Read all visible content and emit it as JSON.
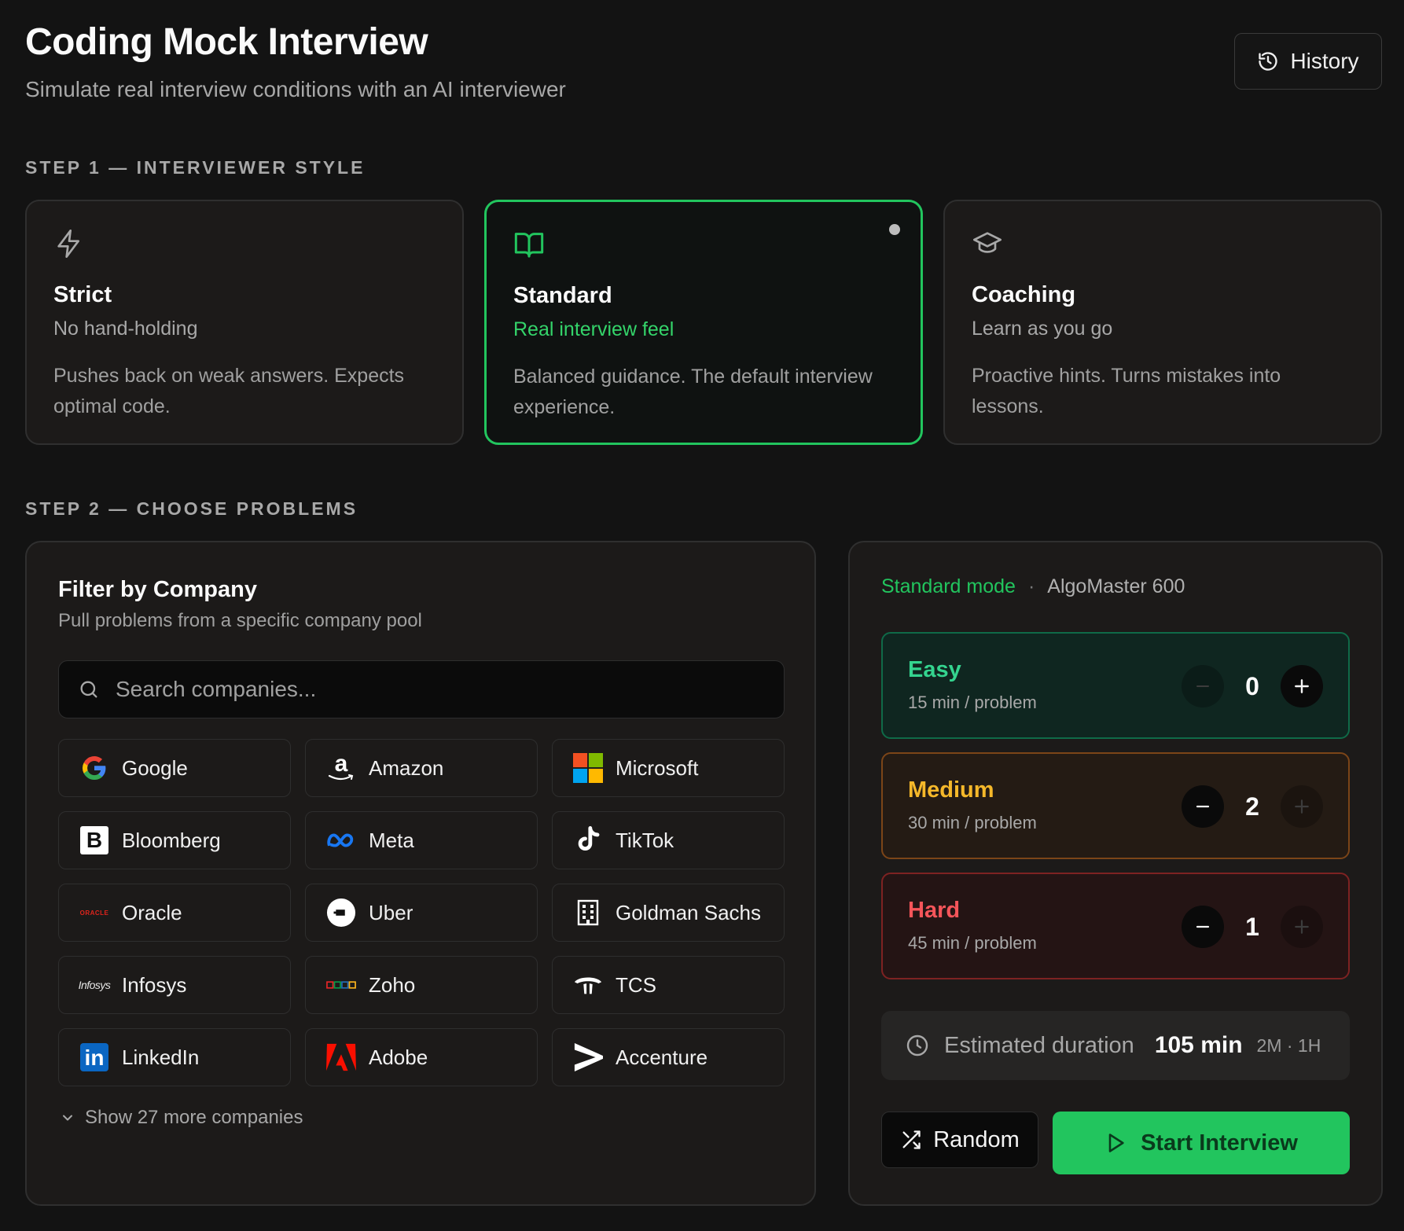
{
  "header": {
    "title": "Coding Mock Interview",
    "subtitle": "Simulate real interview conditions with an AI interviewer",
    "history_label": "History"
  },
  "step1": {
    "label": "STEP 1 — INTERVIEWER STYLE",
    "styles": [
      {
        "name": "Strict",
        "tagline": "No hand-holding",
        "description": "Pushes back on weak answers. Expects optimal code.",
        "icon": "lightning-icon",
        "selected": false
      },
      {
        "name": "Standard",
        "tagline": "Real interview feel",
        "description": "Balanced guidance. The default interview experience.",
        "icon": "book-open-icon",
        "selected": true
      },
      {
        "name": "Coaching",
        "tagline": "Learn as you go",
        "description": "Proactive hints. Turns mistakes into lessons.",
        "icon": "graduation-cap-icon",
        "selected": false
      }
    ]
  },
  "step2": {
    "label": "STEP 2 — CHOOSE PROBLEMS"
  },
  "filter": {
    "title": "Filter by Company",
    "subtitle": "Pull problems from a specific company pool",
    "search_placeholder": "Search companies...",
    "companies": [
      {
        "name": "Google",
        "logo": "google-logo"
      },
      {
        "name": "Amazon",
        "logo": "amazon-logo"
      },
      {
        "name": "Microsoft",
        "logo": "microsoft-logo"
      },
      {
        "name": "Bloomberg",
        "logo": "bloomberg-logo"
      },
      {
        "name": "Meta",
        "logo": "meta-logo"
      },
      {
        "name": "TikTok",
        "logo": "tiktok-logo"
      },
      {
        "name": "Oracle",
        "logo": "oracle-logo"
      },
      {
        "name": "Uber",
        "logo": "uber-logo"
      },
      {
        "name": "Goldman Sachs",
        "logo": "building-icon"
      },
      {
        "name": "Infosys",
        "logo": "infosys-logo"
      },
      {
        "name": "Zoho",
        "logo": "zoho-logo"
      },
      {
        "name": "TCS",
        "logo": "tcs-logo"
      },
      {
        "name": "LinkedIn",
        "logo": "linkedin-logo"
      },
      {
        "name": "Adobe",
        "logo": "adobe-logo"
      },
      {
        "name": "Accenture",
        "logo": "accenture-logo"
      }
    ],
    "logo_text": {
      "oracle": "ORACLE",
      "infosys": "Infosys",
      "linkedin": "in",
      "bloomberg": "B",
      "amazon": "a"
    },
    "show_more_label": "Show 27 more companies"
  },
  "config": {
    "mode_name": "Standard mode",
    "separator": "·",
    "problem_set": "AlgoMaster 600",
    "difficulties": [
      {
        "name": "Easy",
        "time": "15 min / problem",
        "count": "0",
        "minus_enabled": false,
        "plus_enabled": true
      },
      {
        "name": "Medium",
        "time": "30 min / problem",
        "count": "2",
        "minus_enabled": true,
        "plus_enabled": false
      },
      {
        "name": "Hard",
        "time": "45 min / problem",
        "count": "1",
        "minus_enabled": true,
        "plus_enabled": false
      }
    ],
    "estimate_label": "Estimated duration",
    "estimate_value": "105 min",
    "estimate_breakdown": "2M · 1H",
    "random_label": "Random",
    "start_label": "Start Interview"
  },
  "colors": {
    "accent_green": "#22c55e",
    "easy": "#34d48f",
    "medium": "#f5b82a",
    "hard": "#f5555a",
    "background": "#131313"
  }
}
